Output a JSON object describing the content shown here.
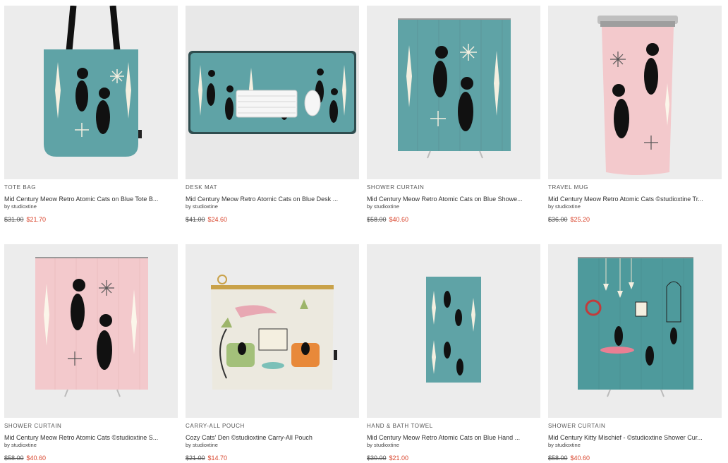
{
  "products": [
    {
      "type": "TOTE BAG",
      "title": "Mid Century Meow Retro Atomic Cats on Blue Tote B...",
      "artist": "by studioxtine",
      "old_price": "$31.00",
      "price": "$21.70",
      "icon": "tote-bag-image"
    },
    {
      "type": "DESK MAT",
      "title": "Mid Century Meow Retro Atomic Cats on Blue Desk ...",
      "artist": "by studioxtine",
      "old_price": "$41.00",
      "price": "$24.60",
      "icon": "desk-mat-image"
    },
    {
      "type": "SHOWER CURTAIN",
      "title": "Mid Century Meow Retro Atomic Cats on Blue Showe...",
      "artist": "by studioxtine",
      "old_price": "$58.00",
      "price": "$40.60",
      "icon": "shower-curtain-image"
    },
    {
      "type": "TRAVEL MUG",
      "title": "Mid Century Meow Retro Atomic Cats ©studioxtine Tr...",
      "artist": "by studioxtine",
      "old_price": "$36.00",
      "price": "$25.20",
      "icon": "travel-mug-image"
    },
    {
      "type": "SHOWER CURTAIN",
      "title": "Mid Century Meow Retro Atomic Cats ©studioxtine S...",
      "artist": "by studioxtine",
      "old_price": "$58.00",
      "price": "$40.60",
      "icon": "shower-curtain-image"
    },
    {
      "type": "CARRY-ALL POUCH",
      "title": "Cozy Cats' Den ©studioxtine Carry-All Pouch",
      "artist": "by studioxtine",
      "old_price": "$21.00",
      "price": "$14.70",
      "icon": "pouch-image"
    },
    {
      "type": "HAND & BATH TOWEL",
      "title": "Mid Century Meow Retro Atomic Cats on Blue Hand ...",
      "artist": "by studioxtine",
      "old_price": "$30.00",
      "price": "$21.00",
      "icon": "towel-image"
    },
    {
      "type": "SHOWER CURTAIN",
      "title": "Mid Century Kitty Mischief - ©studioxtine Shower Cur...",
      "artist": "by studioxtine",
      "old_price": "$58.00",
      "price": "$40.60",
      "icon": "shower-curtain-image"
    }
  ],
  "colors": {
    "teal": "#5fa3a6",
    "pink": "#f3c9cc",
    "sale_red": "#d9452d",
    "thumb_bg": "#ececec"
  }
}
